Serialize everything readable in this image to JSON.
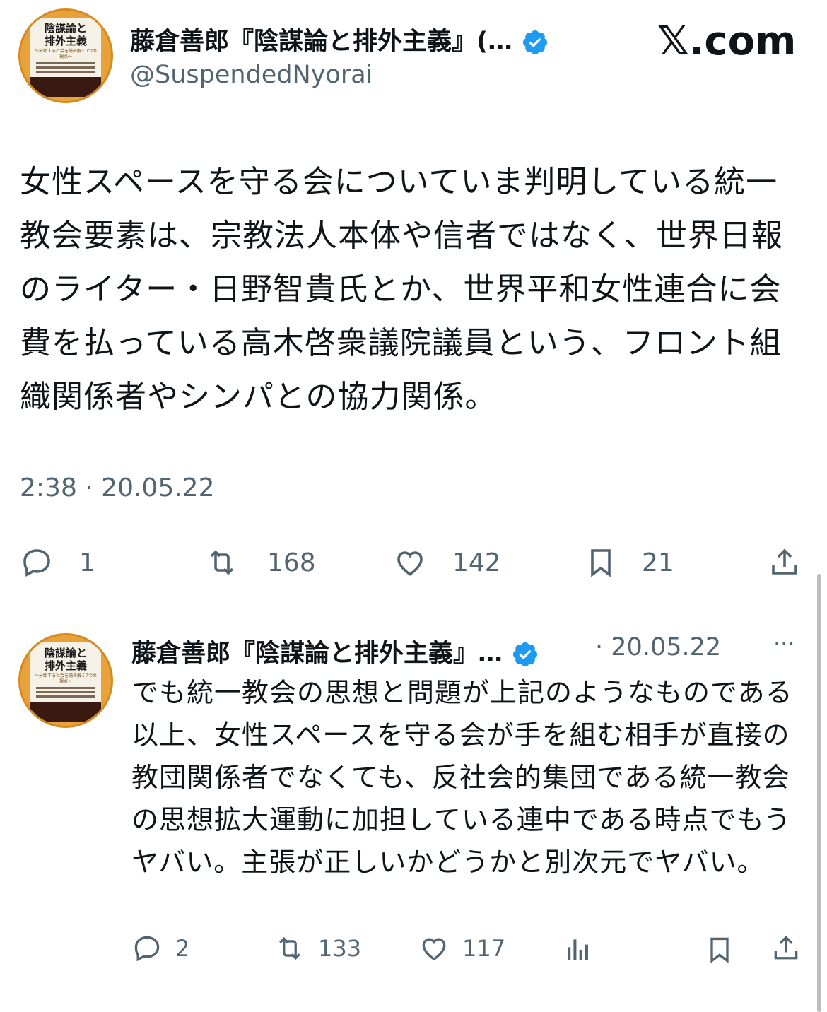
{
  "tweet": {
    "author_name": "藤倉善郎『陰謀論と排外主義』(…",
    "handle": "@SuspendedNyorai",
    "avatar": {
      "title_line1": "陰謀論と",
      "title_line2": "排外主義",
      "subtitle": "〜分断する社会を読み解く7つの視点〜",
      "icon": "book-cover-avatar"
    },
    "site_logo": "𝕏.com",
    "text": "女性スペースを守る会についていま判明している統一教会要素は、宗教法人本体や信者ではなく、世界日報のライター・日野智貴氏とか、世界平和女性連合に会費を払っている高木啓衆議院議員という、フロント組織関係者やシンパとの協力関係。",
    "timestamp": "2:38 · 20.05.22",
    "actions": {
      "replies": "1",
      "reposts": "168",
      "likes": "142",
      "bookmarks": "21"
    },
    "verified_color": "#1d9bf0"
  },
  "reply": {
    "author_name": "藤倉善郎『陰謀論と排外主義』…",
    "separator": "·",
    "date": "20.05.22",
    "more": "···",
    "text": "でも統一教会の思想と問題が上記のようなものである以上、女性スペースを守る会が手を組む相手が直接の教団関係者でなくても、反社会的集団である統一教会の思想拡大運動に加担している連中である時点でもうヤバい。主張が正しいかどうかと別次元でヤバい。",
    "actions": {
      "replies": "2",
      "reposts": "133",
      "likes": "117"
    }
  },
  "colors": {
    "text": "#0f1419",
    "secondary": "#536471",
    "verified": "#1d9bf0"
  }
}
